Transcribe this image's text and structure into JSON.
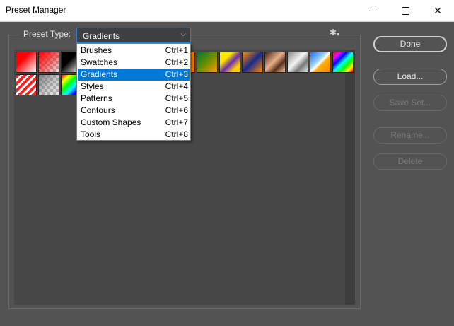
{
  "window": {
    "title": "Preset Manager"
  },
  "preset_type": {
    "label": "Preset Type:",
    "selected": "Gradients",
    "menu": [
      {
        "label": "Brushes",
        "shortcut": "Ctrl+1",
        "selected": false
      },
      {
        "label": "Swatches",
        "shortcut": "Ctrl+2",
        "selected": false
      },
      {
        "label": "Gradients",
        "shortcut": "Ctrl+3",
        "selected": true
      },
      {
        "label": "Styles",
        "shortcut": "Ctrl+4",
        "selected": false
      },
      {
        "label": "Patterns",
        "shortcut": "Ctrl+5",
        "selected": false
      },
      {
        "label": "Contours",
        "shortcut": "Ctrl+6",
        "selected": false
      },
      {
        "label": "Custom Shapes",
        "shortcut": "Ctrl+7",
        "selected": false
      },
      {
        "label": "Tools",
        "shortcut": "Ctrl+8",
        "selected": false
      }
    ]
  },
  "buttons": {
    "done": "Done",
    "load": "Load...",
    "save_set": "Save Set...",
    "rename": "Rename...",
    "delete": "Delete"
  },
  "colors": {
    "accent": "#0078d7",
    "dialog_bg": "#535353",
    "list_bg": "#474747"
  }
}
